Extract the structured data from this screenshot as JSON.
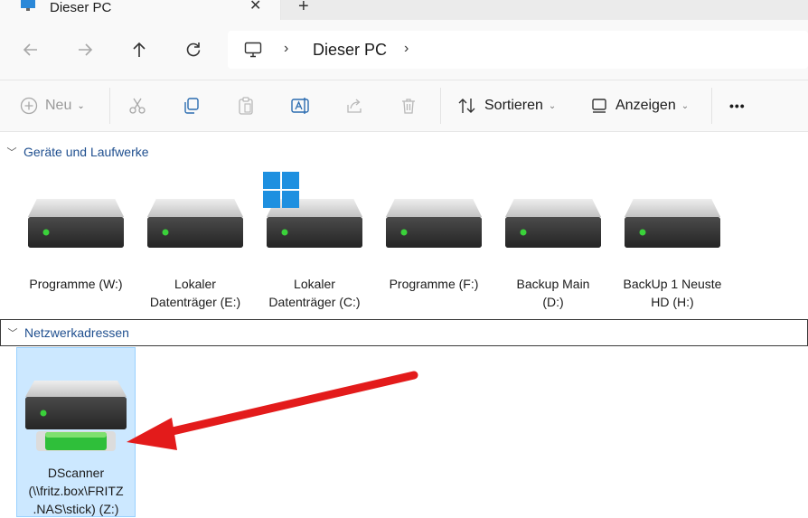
{
  "tab": {
    "title": "Dieser PC",
    "close_glyph": "✕",
    "new_glyph": "+"
  },
  "nav": {
    "back_icon": "arrow-left-icon",
    "forward_icon": "arrow-right-icon",
    "up_icon": "arrow-up-icon",
    "refresh_icon": "refresh-icon",
    "address": "Dieser PC",
    "chevron": "›"
  },
  "commands": {
    "new_label": "Neu",
    "sort_label": "Sortieren",
    "view_label": "Anzeigen",
    "more_label": "•••"
  },
  "groups": {
    "devices_label": "Geräte und Laufwerke",
    "network_label": "Netzwerkadressen"
  },
  "drives": [
    {
      "line1": "Programme (W:)",
      "line2": ""
    },
    {
      "line1": "Lokaler",
      "line2": "Datenträger (E:)"
    },
    {
      "line1": "Lokaler",
      "line2": "Datenträger (C:)"
    },
    {
      "line1": "Programme (F:)",
      "line2": ""
    },
    {
      "line1": "Backup Main",
      "line2": "(D:)"
    },
    {
      "line1": "BackUp 1 Neuste",
      "line2": "HD  (H:)"
    }
  ],
  "network": {
    "line1": "DScanner",
    "line2": "(\\\\fritz.box\\FRITZ",
    "line3": ".NAS\\stick) (Z:)"
  },
  "colors": {
    "accent_blue": "#1f4f8f",
    "drive_led": "#3ad13a",
    "selection": "#cce8ff",
    "arrow_red": "#e31b1b",
    "win_blue": "#1e90e0"
  }
}
